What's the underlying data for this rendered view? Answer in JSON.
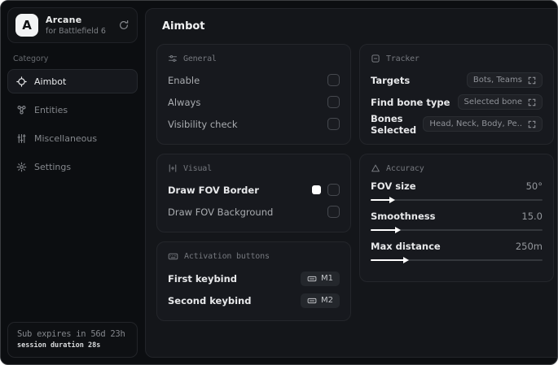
{
  "sidebar": {
    "logo_letter": "A",
    "app_name": "Arcane",
    "app_subtitle": "for Battlefield 6",
    "category_label": "Category",
    "items": [
      {
        "label": "Aimbot",
        "selected": true
      },
      {
        "label": "Entities",
        "selected": false
      },
      {
        "label": "Miscellaneous",
        "selected": false
      },
      {
        "label": "Settings",
        "selected": false
      }
    ],
    "subscription": {
      "expires": "Sub expires in 56d 23h",
      "session": "session duration 28s"
    }
  },
  "main": {
    "title": "Aimbot",
    "general": {
      "title": "General",
      "rows": [
        {
          "label": "Enable",
          "checked": false
        },
        {
          "label": "Always",
          "checked": false
        },
        {
          "label": "Visibility check",
          "checked": false
        }
      ]
    },
    "visual": {
      "title": "Visual",
      "rows": [
        {
          "label": "Draw FOV Border",
          "checked": false,
          "swatch_color": "#ffffff"
        },
        {
          "label": "Draw FOV Background",
          "checked": false
        }
      ]
    },
    "activation": {
      "title": "Activation buttons",
      "rows": [
        {
          "label": "First keybind",
          "key": "M1"
        },
        {
          "label": "Second keybind",
          "key": "M2"
        }
      ]
    },
    "tracker": {
      "title": "Tracker",
      "rows": [
        {
          "label": "Targets",
          "value": "Bots, Teams"
        },
        {
          "label": "Find bone type",
          "value": "Selected bone"
        },
        {
          "label": "Bones Selected",
          "value": "Head, Neck, Body, Pe.."
        }
      ]
    },
    "accuracy": {
      "title": "Accuracy",
      "sliders": [
        {
          "label": "FOV size",
          "value": "50°",
          "percent_css": "13%"
        },
        {
          "label": "Smoothness",
          "value": "15.0",
          "percent_css": "16%"
        },
        {
          "label": "Max distance",
          "value": "250m",
          "percent_css": "21%"
        }
      ]
    }
  },
  "colors": {
    "panel_bg": "#14161a",
    "card_bg": "#17191e",
    "sidebar_bg": "#0c0e11",
    "accent_fill": "#ffffff",
    "text_bright": "#e9eaec",
    "text_muted": "#85888d"
  }
}
